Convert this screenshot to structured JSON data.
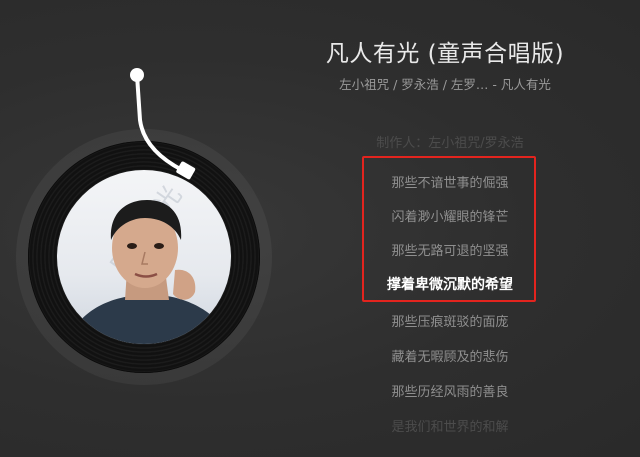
{
  "song": {
    "title": "凡人有光 (童声合唱版)",
    "artists": "左小祖咒 / 罗永浩 / 左罗… - 凡人有光"
  },
  "player": {
    "cover_watermark": "凡人有光"
  },
  "lyrics": [
    "制作人：左小祖咒/罗永浩",
    "那些不谙世事的倔强",
    "闪着渺小耀眼的锋芒",
    "那些无路可退的坚强",
    "撑着卑微沉默的希望",
    "那些压痕斑驳的面庞",
    "藏着无暇顾及的悲伤",
    "那些历经风雨的善良",
    "是我们和世界的和解"
  ],
  "active_lyric_index": 4,
  "colors": {
    "background": "#2f2f2f",
    "highlight_border": "#e3241e",
    "active_lyric": "#ffffff",
    "inactive_lyric": "#8f8f8f"
  }
}
